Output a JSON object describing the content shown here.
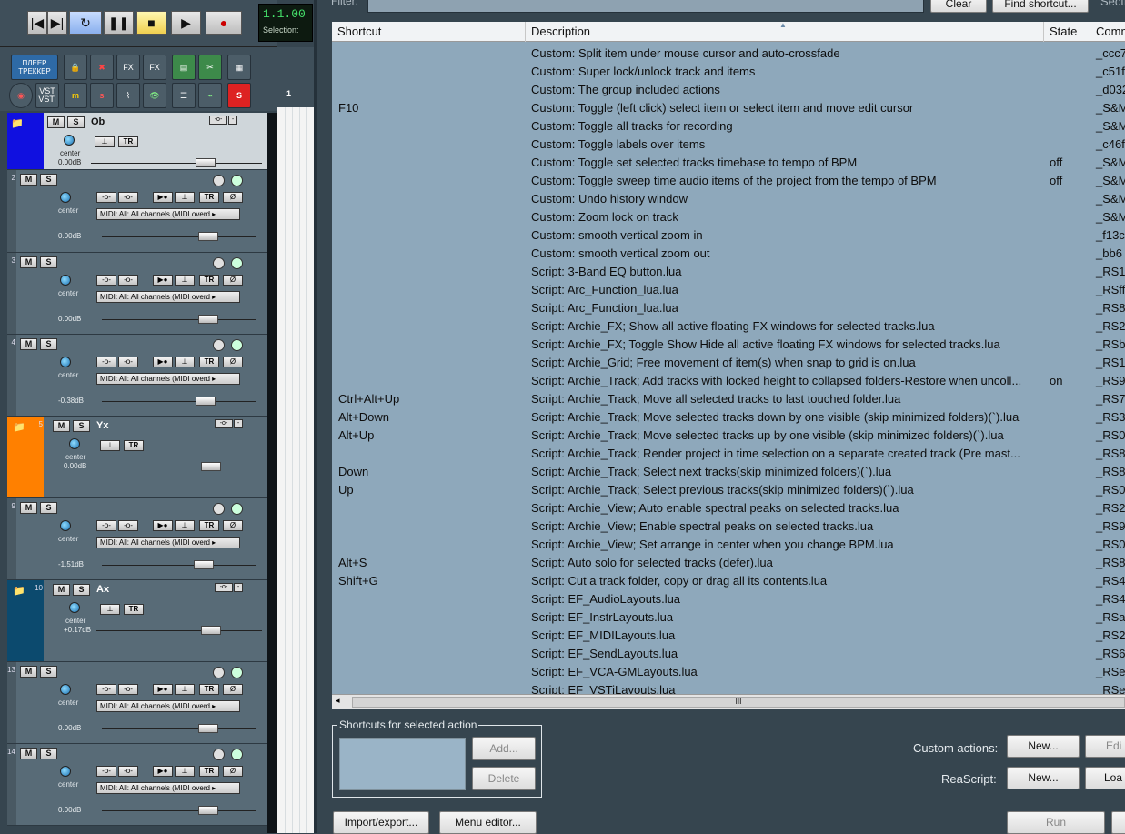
{
  "transport": {
    "time": "1.1.00",
    "selection_label": "Selection:",
    "buttons": [
      "|◀",
      "▶|",
      "↻",
      "❚❚",
      "■",
      "▶",
      "●"
    ]
  },
  "toolbar": {
    "row1": [
      "ПЛЕЕР ТРЕККЕР",
      "lock",
      "fx-red",
      "FX",
      "FX",
      "mixer",
      "cut",
      "grid"
    ],
    "row2": [
      "rec",
      "VST VSTi",
      "m",
      "s",
      "env",
      "eye",
      "list",
      "env2",
      "S"
    ]
  },
  "ruler": {
    "mark": "1"
  },
  "tracks": [
    {
      "num": "",
      "name": "Ob",
      "m": "M",
      "s": "S",
      "pan": "center",
      "vol": "0.00dB",
      "type": "folder"
    },
    {
      "num": "2",
      "name": "",
      "m": "M",
      "s": "S",
      "pan": "center",
      "vol": "0.00dB",
      "midi": "MIDI: All: All channels (MIDI overd ▸",
      "type": "child"
    },
    {
      "num": "3",
      "name": "",
      "m": "M",
      "s": "S",
      "pan": "center",
      "vol": "0.00dB",
      "midi": "MIDI: All: All channels (MIDI overd ▸",
      "type": "child"
    },
    {
      "num": "4",
      "name": "",
      "m": "M",
      "s": "S",
      "pan": "center",
      "vol": "-0.38dB",
      "midi": "MIDI: All: All channels (MIDI overd ▸",
      "type": "child"
    },
    {
      "num": "5",
      "name": "Yx",
      "m": "M",
      "s": "S",
      "pan": "center",
      "vol": "0.00dB",
      "type": "folder-orange"
    },
    {
      "num": "9",
      "name": "",
      "m": "M",
      "s": "S",
      "pan": "center",
      "vol": "-1.51dB",
      "midi": "MIDI: All: All channels (MIDI overd ▸",
      "type": "child"
    },
    {
      "num": "10",
      "name": "Ax",
      "m": "M",
      "s": "S",
      "pan": "center",
      "vol": "+0.17dB",
      "type": "folder-teal"
    },
    {
      "num": "13",
      "name": "",
      "m": "M",
      "s": "S",
      "pan": "center",
      "vol": "0.00dB",
      "midi": "MIDI: All: All channels (MIDI overd ▸",
      "type": "child"
    },
    {
      "num": "14",
      "name": "",
      "m": "M",
      "s": "S",
      "pan": "center",
      "vol": "0.00dB",
      "midi": "MIDI: All: All channels (MIDI overd ▸",
      "type": "child"
    }
  ],
  "track_labels": {
    "tr": "TR",
    "phase": "Ø"
  },
  "dialog": {
    "filter_label": "Filter:",
    "clear": "Clear",
    "find_shortcut": "Find shortcut...",
    "section_label": "Secti",
    "columns": [
      "Shortcut",
      "Description",
      "State",
      "Comm"
    ],
    "rows": [
      {
        "shortcut": "",
        "desc": "Custom: Split item under mouse cursor and auto-crossfade",
        "state": "",
        "cmd": "_ccc7"
      },
      {
        "shortcut": "",
        "desc": "Custom: Super lock/unlock track and items",
        "state": "",
        "cmd": "_c51f"
      },
      {
        "shortcut": "",
        "desc": "Custom: The group included actions",
        "state": "",
        "cmd": "_d032"
      },
      {
        "shortcut": "F10",
        "desc": "Custom: Toggle (left click) select item or select item and move edit cursor",
        "state": "",
        "cmd": "_S&M"
      },
      {
        "shortcut": "",
        "desc": "Custom: Toggle all tracks for recording",
        "state": "",
        "cmd": "_S&M"
      },
      {
        "shortcut": "",
        "desc": "Custom: Toggle labels over items",
        "state": "",
        "cmd": "_c46f"
      },
      {
        "shortcut": "",
        "desc": "Custom: Toggle set selected tracks timebase to tempo of BPM",
        "state": "off",
        "cmd": "_S&M"
      },
      {
        "shortcut": "",
        "desc": "Custom: Toggle sweep time audio items of the project from the tempo of BPM",
        "state": "off",
        "cmd": "_S&M"
      },
      {
        "shortcut": "",
        "desc": "Custom: Undo history window",
        "state": "",
        "cmd": "_S&M"
      },
      {
        "shortcut": "",
        "desc": "Custom: Zoom lock on track",
        "state": "",
        "cmd": "_S&M"
      },
      {
        "shortcut": "",
        "desc": "Custom: smooth vertical zoom in",
        "state": "",
        "cmd": "_f13c"
      },
      {
        "shortcut": "",
        "desc": "Custom: smooth vertical zoom out",
        "state": "",
        "cmd": "_bb6"
      },
      {
        "shortcut": "",
        "desc": "Script: 3-Band EQ button.lua",
        "state": "",
        "cmd": "_RS1"
      },
      {
        "shortcut": "",
        "desc": "Script: Arc_Function_lua.lua",
        "state": "",
        "cmd": "_RSff"
      },
      {
        "shortcut": "",
        "desc": "Script: Arc_Function_lua.lua",
        "state": "",
        "cmd": "_RS8"
      },
      {
        "shortcut": "",
        "desc": "Script: Archie_FX;  Show all active floating FX windows for selected tracks.lua",
        "state": "",
        "cmd": "_RS2"
      },
      {
        "shortcut": "",
        "desc": "Script: Archie_FX;  Toggle Show Hide all active floating FX windows for selected tracks.lua",
        "state": "",
        "cmd": "_RSb"
      },
      {
        "shortcut": "",
        "desc": "Script: Archie_Grid; Free movement of item(s) when snap to grid is on.lua",
        "state": "",
        "cmd": "_RS1"
      },
      {
        "shortcut": "",
        "desc": "Script: Archie_Track;  Add tracks with locked height to collapsed folders-Restore when uncoll...",
        "state": "on",
        "cmd": "_RS9"
      },
      {
        "shortcut": "Ctrl+Alt+Up",
        "desc": "Script: Archie_Track;  Move all selected tracks to last touched folder.lua",
        "state": "",
        "cmd": "_RS7"
      },
      {
        "shortcut": "Alt+Down",
        "desc": "Script: Archie_Track;  Move selected tracks down by one visible (skip minimized folders)(`).lua",
        "state": "",
        "cmd": "_RS3"
      },
      {
        "shortcut": "Alt+Up",
        "desc": "Script: Archie_Track;  Move selected tracks up by one visible (skip minimized folders)(`).lua",
        "state": "",
        "cmd": "_RS0"
      },
      {
        "shortcut": "",
        "desc": "Script: Archie_Track;  Render project in time selection on a separate created track (Pre mast...",
        "state": "",
        "cmd": "_RS8"
      },
      {
        "shortcut": "Down",
        "desc": "Script: Archie_Track;  Select next tracks(skip minimized folders)(`).lua",
        "state": "",
        "cmd": "_RS8"
      },
      {
        "shortcut": "Up",
        "desc": "Script: Archie_Track;  Select previous tracks(skip minimized folders)(`).lua",
        "state": "",
        "cmd": "_RS0"
      },
      {
        "shortcut": "",
        "desc": "Script: Archie_View;  Auto enable spectral peaks on selected tracks.lua",
        "state": "",
        "cmd": "_RS2"
      },
      {
        "shortcut": "",
        "desc": "Script: Archie_View;  Enable spectral peaks on selected tracks.lua",
        "state": "",
        "cmd": "_RS9"
      },
      {
        "shortcut": "",
        "desc": "Script: Archie_View;  Set arrange in center when you change BPM.lua",
        "state": "",
        "cmd": "_RS0"
      },
      {
        "shortcut": "Alt+S",
        "desc": "Script: Auto solo for selected tracks (defer).lua",
        "state": "",
        "cmd": "_RS8"
      },
      {
        "shortcut": "Shift+G",
        "desc": "Script: Cut a track folder, copy or drag all its contents.lua",
        "state": "",
        "cmd": "_RS4"
      },
      {
        "shortcut": "",
        "desc": "Script: EF_AudioLayouts.lua",
        "state": "",
        "cmd": "_RS4"
      },
      {
        "shortcut": "",
        "desc": "Script: EF_InstrLayouts.lua",
        "state": "",
        "cmd": "_RSa"
      },
      {
        "shortcut": "",
        "desc": "Script: EF_MIDILayouts.lua",
        "state": "",
        "cmd": "_RS2"
      },
      {
        "shortcut": "",
        "desc": "Script: EF_SendLayouts.lua",
        "state": "",
        "cmd": "_RS6"
      },
      {
        "shortcut": "",
        "desc": "Script: EF_VCA-GMLayouts.lua",
        "state": "",
        "cmd": "_RSe"
      },
      {
        "shortcut": "",
        "desc": "Script: EF_VSTiLayouts.lua",
        "state": "",
        "cmd": "_RSe"
      }
    ],
    "scroll_thumb": "III",
    "shortcuts_group_title": "Shortcuts for selected action",
    "add": "Add...",
    "delete": "Delete",
    "custom_actions_label": "Custom actions:",
    "custom_new": "New...",
    "custom_edit": "Edi",
    "reascript_label": "ReaScript:",
    "reascript_new": "New...",
    "reascript_load": "Loa",
    "import_export": "Import/export...",
    "menu_editor": "Menu editor...",
    "run": "Run"
  }
}
